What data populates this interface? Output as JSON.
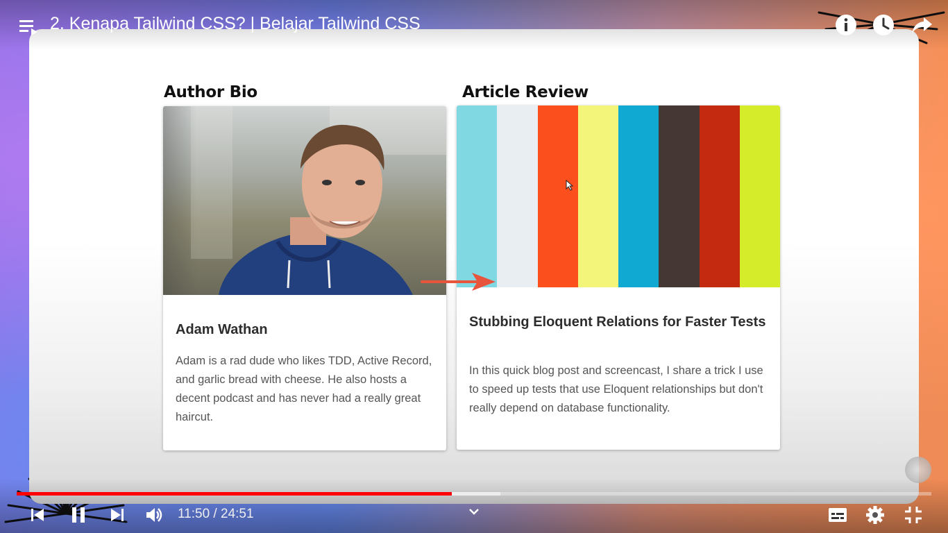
{
  "video": {
    "title": "2. Kenapa Tailwind CSS? | Belajar Tailwind CSS",
    "current_time": "11:50",
    "duration": "24:51",
    "time_display": "11:50 / 24:51",
    "progress_fraction": 0.476,
    "buffered_fraction": 0.529
  },
  "slide": {
    "author_section_heading": "Author Bio",
    "article_section_heading": "Article Review",
    "author_card": {
      "name": "Adam Wathan",
      "bio": "Adam is a rad dude who likes TDD, Active Record, and garlic bread with cheese. He also hosts a decent podcast and has never had a really great haircut."
    },
    "article_card": {
      "title": "Stubbing Eloquent Relations for Faster Tests",
      "excerpt": "In this quick blog post and screencast, I share a trick I use to speed up tests that use Eloquent relationships but don't really depend on database functionality.",
      "stripe_colors": [
        "#7fd8e2",
        "#e9eef2",
        "#fb4f1e",
        "#f2f57a",
        "#10a9d2",
        "#453834",
        "#c32a10",
        "#d4ec2a"
      ]
    }
  },
  "icons": {
    "top": [
      "playlist-icon",
      "info-icon",
      "watch-later-icon",
      "share-icon"
    ],
    "controls": [
      "previous-icon",
      "pause-icon",
      "next-icon",
      "volume-icon",
      "chevron-down-icon",
      "subtitles-icon",
      "settings-icon",
      "exit-fullscreen-icon"
    ]
  },
  "colors": {
    "progress_played": "#ff0000",
    "arrow": "#e8553d"
  }
}
